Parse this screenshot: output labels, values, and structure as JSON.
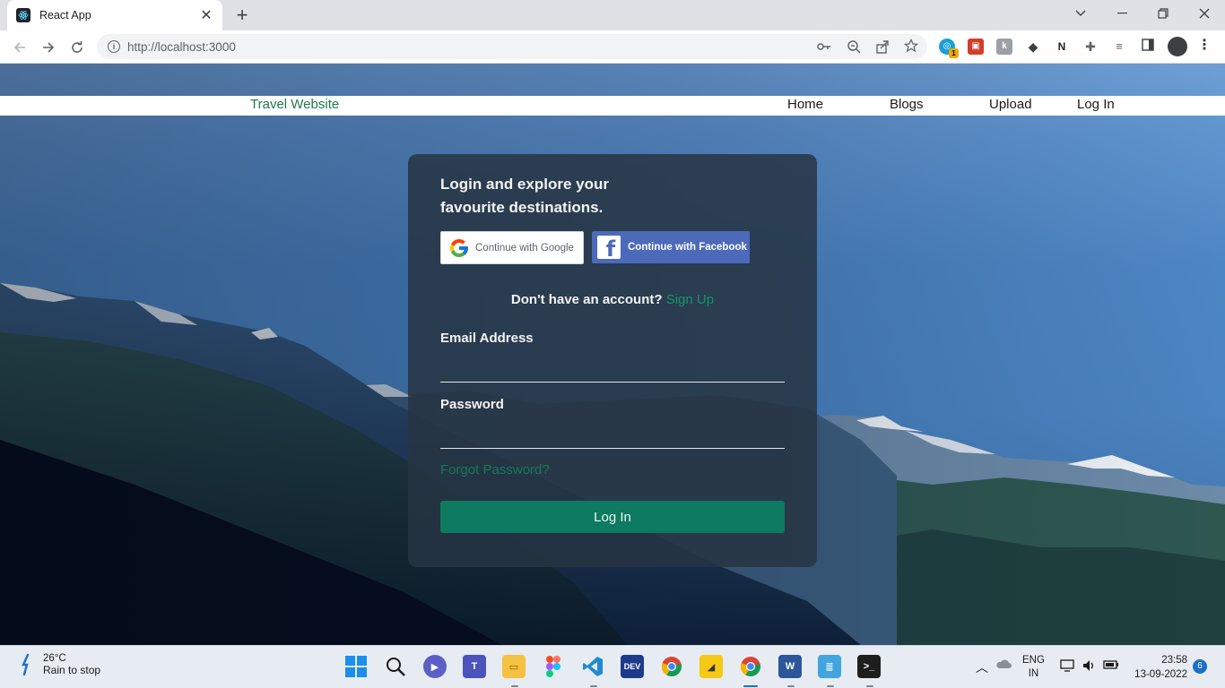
{
  "browser": {
    "tab_title": "React App",
    "url": "http://localhost:3000"
  },
  "site": {
    "brand": "Travel Website",
    "nav": [
      "Home",
      "Blogs",
      "Upload",
      "Log In"
    ]
  },
  "login": {
    "heading_line1": "Login and explore your",
    "heading_line2": "favourite destinations.",
    "google_label": "Continue with Google",
    "facebook_label": "Continue with Facebook",
    "no_account": "Don't have an account?",
    "signup_link": "Sign Up",
    "email_label": "Email Address",
    "email_value": "",
    "password_label": "Password",
    "password_value": "",
    "forgot": "Forgot Password?",
    "submit": "Log In",
    "colors": {
      "accent": "#0e7a62",
      "link": "#17946a",
      "facebook": "#4c69ba"
    }
  },
  "taskbar": {
    "temperature": "26°C",
    "weather": "Rain to stop",
    "lang1": "ENG",
    "lang2": "IN",
    "time": "23:58",
    "date": "13-09-2022",
    "notifications": "6",
    "ext_badge": "1",
    "apps": [
      "start-icon",
      "search-icon",
      "chat-icon",
      "teams-icon",
      "file-explorer-icon",
      "figma-icon",
      "vscode-icon",
      "devc-icon",
      "chrome-icon",
      "sticky-notes-icon",
      "chrome-active-icon",
      "word-icon",
      "notepad-icon",
      "terminal-icon"
    ]
  }
}
